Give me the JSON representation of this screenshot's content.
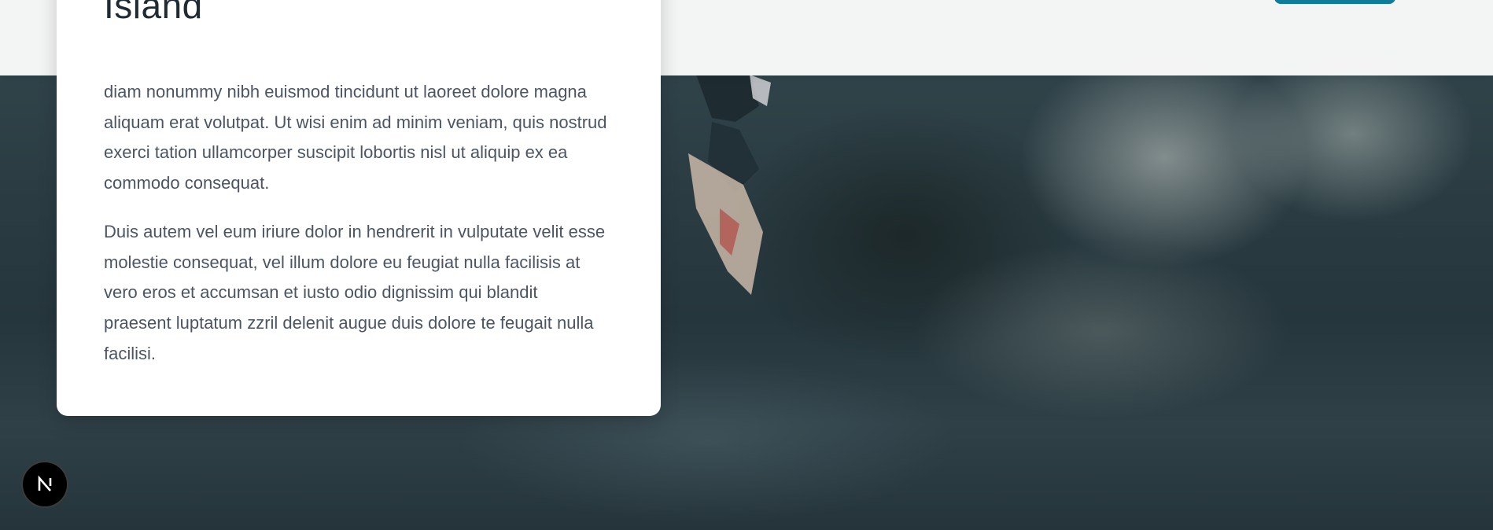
{
  "card": {
    "title": "Island",
    "paragraphs": [
      "diam nonummy nibh euismod tincidunt ut laoreet dolore magna aliquam erat volutpat. Ut wisi enim ad minim veniam, quis nostrud exerci tation ullamcorper suscipit lobortis nisl ut aliquip ex ea commodo consequat.",
      "Duis autem vel eum iriure dolor in hendrerit in vulputate velit esse molestie consequat, vel illum dolore eu feugiat nulla facilisis at vero eros et accumsan et iusto odio dignissim qui blandit praesent luptatum zzril delenit augue duis dolore te feugait nulla facilisi."
    ]
  },
  "header": {
    "cta_color": "#0e7c9b"
  },
  "badge": {
    "letter": "N",
    "icon": "nextjs-icon"
  },
  "hero": {
    "image": "surfer-on-wave"
  }
}
